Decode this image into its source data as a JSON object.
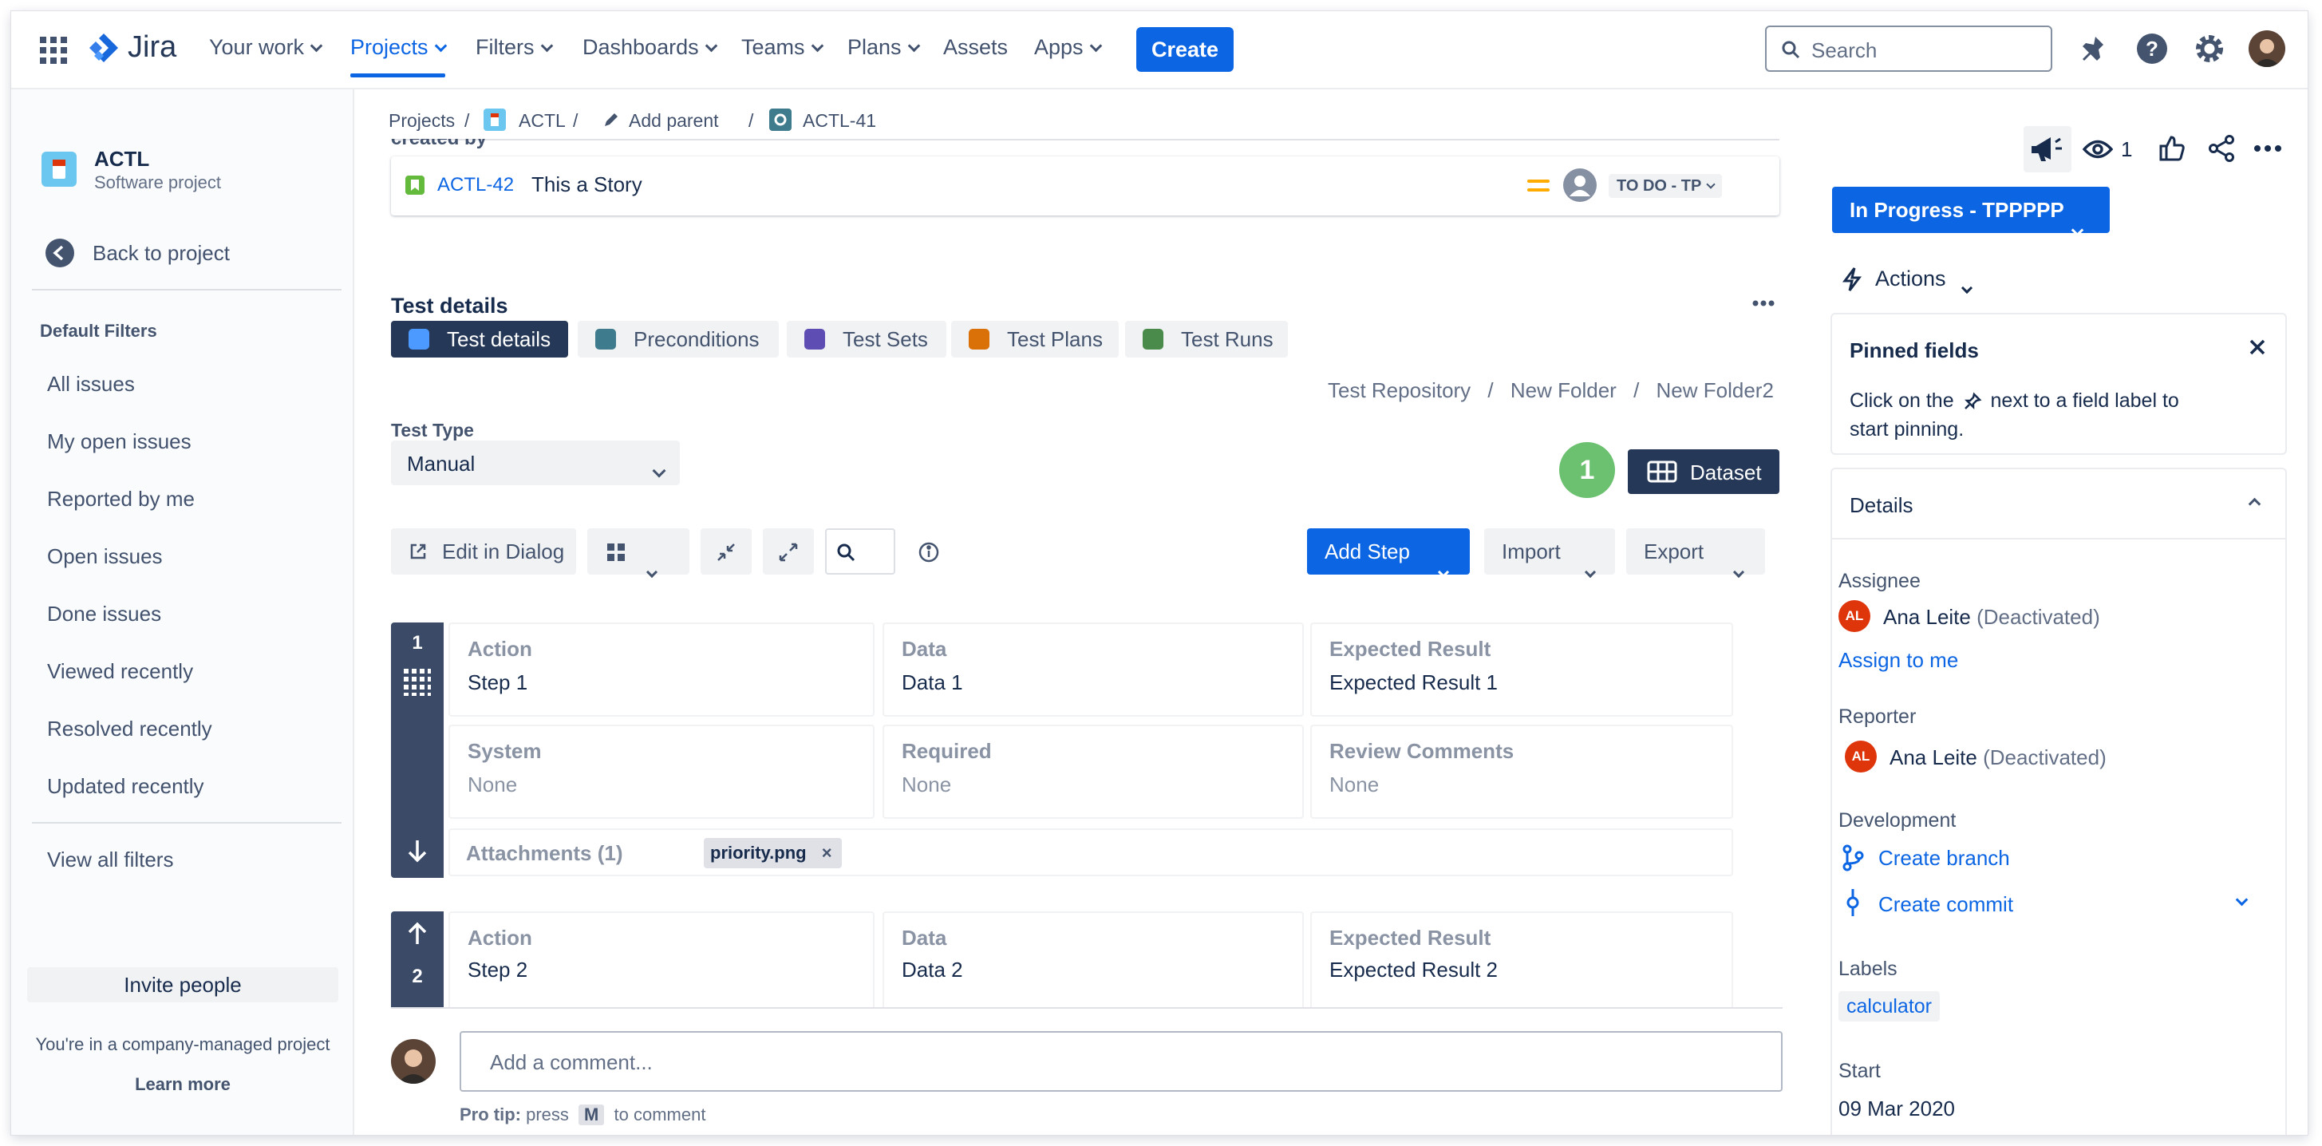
{
  "nav": {
    "logo": "Jira",
    "items": [
      "Your work",
      "Projects",
      "Filters",
      "Dashboards",
      "Teams",
      "Plans",
      "Assets",
      "Apps"
    ],
    "create": "Create",
    "search_placeholder": "Search"
  },
  "sidebar": {
    "project_name": "ACTL",
    "project_type": "Software project",
    "back": "Back to project",
    "section": "Default Filters",
    "filters": [
      "All issues",
      "My open issues",
      "Reported by me",
      "Open issues",
      "Done issues",
      "Viewed recently",
      "Resolved recently",
      "Updated recently"
    ],
    "view_all": "View all filters",
    "invite": "Invite people",
    "managed_note": "You're in a company-managed project",
    "learn_more": "Learn more"
  },
  "breadcrumb": {
    "projects": "Projects",
    "project": "ACTL",
    "add_parent": "Add parent",
    "issue": "ACTL-41"
  },
  "linked": {
    "section_label": "created by",
    "key": "ACTL-42",
    "summary": "This a Story",
    "status": "TO DO - TP"
  },
  "test_details": {
    "title": "Test details",
    "tabs": [
      "Test details",
      "Preconditions",
      "Test Sets",
      "Test Plans",
      "Test Runs"
    ],
    "repo_path": [
      "Test Repository",
      "New Folder",
      "New Folder2"
    ],
    "test_type_label": "Test Type",
    "test_type_value": "Manual",
    "dataset_count": "1",
    "dataset": "Dataset",
    "toolbar": {
      "edit_dialog": "Edit in Dialog",
      "add_step": "Add Step",
      "import": "Import",
      "export": "Export"
    },
    "steps": [
      {
        "index": "1",
        "action_label": "Action",
        "action": "Step 1",
        "data_label": "Data",
        "data": "Data 1",
        "expected_label": "Expected Result",
        "expected": "Expected Result 1",
        "system_label": "System",
        "system": "None",
        "required_label": "Required",
        "required": "None",
        "review_label": "Review Comments",
        "review": "None",
        "attachments_label": "Attachments (1)",
        "attachment": "priority.png"
      },
      {
        "index": "2",
        "action_label": "Action",
        "action": "Step 2",
        "data_label": "Data",
        "data": "Data 2",
        "expected_label": "Expected Result",
        "expected": "Expected Result 2"
      }
    ]
  },
  "comment": {
    "placeholder": "Add a comment...",
    "tip_prefix": "Pro tip:",
    "tip_press": "press",
    "tip_key": "M",
    "tip_suffix": "to comment"
  },
  "right": {
    "watch_count": "1",
    "status": "In Progress - TPPPPP",
    "actions": "Actions",
    "pinned_title": "Pinned fields",
    "pinned_text_1": "Click on the",
    "pinned_text_2": "next to a field label to",
    "pinned_text_3": "start pinning.",
    "details": "Details",
    "assignee_label": "Assignee",
    "assignee_initials": "AL",
    "assignee_name": "Ana Leite",
    "assignee_note": "(Deactivated)",
    "assign_to_me": "Assign to me",
    "reporter_label": "Reporter",
    "reporter_initials": "AL",
    "reporter_name": "Ana Leite",
    "reporter_note": "(Deactivated)",
    "development_label": "Development",
    "create_branch": "Create branch",
    "create_commit": "Create commit",
    "labels_label": "Labels",
    "label": "calculator",
    "start_label": "Start",
    "start_value": "09 Mar 2020"
  },
  "colors": {
    "primary": "#0c66e4",
    "dark": "#253858",
    "green": "#6bc16f",
    "avatar": "#de350b"
  }
}
